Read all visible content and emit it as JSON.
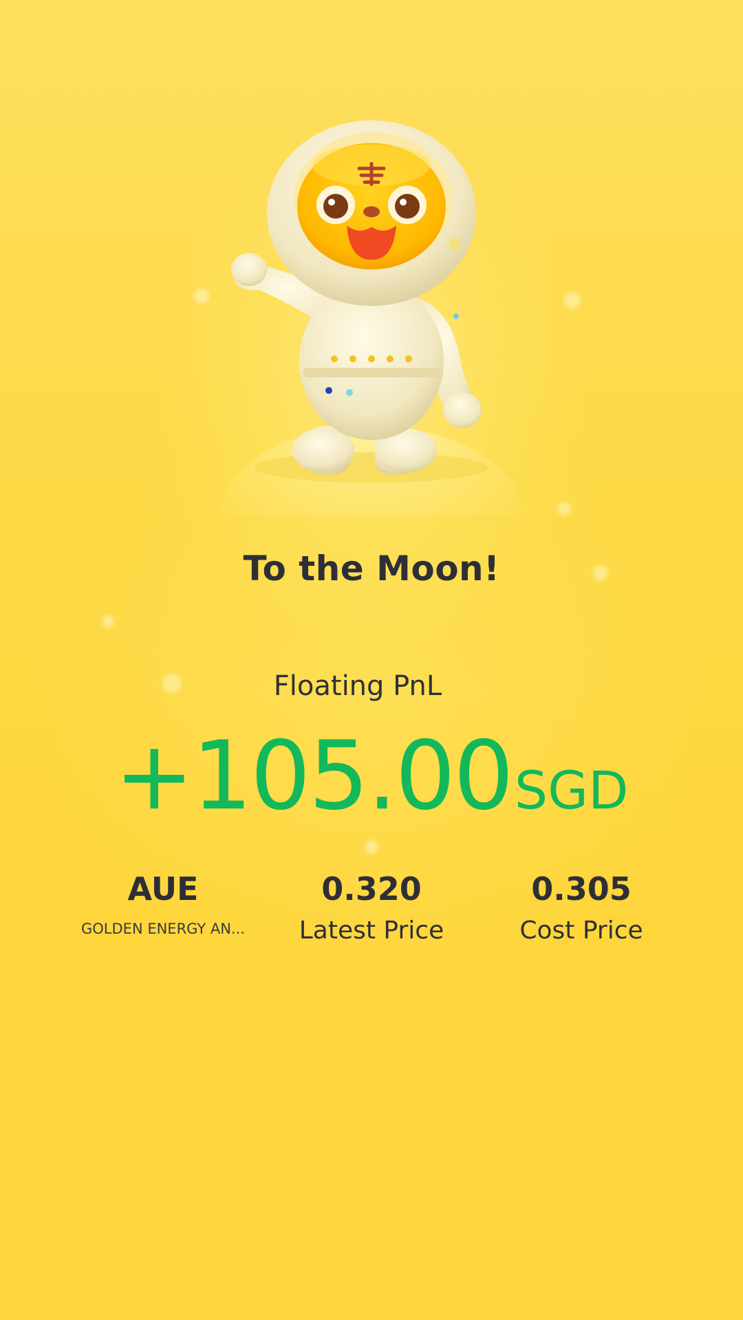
{
  "theme": {
    "background": "#fdd93a",
    "text_color": "#2e2f36",
    "profit_color": "#12b85a"
  },
  "hero": {
    "illustration": "astronaut-tiger-mascot",
    "title": "To the Moon!"
  },
  "pnl": {
    "label": "Floating PnL",
    "amount": "+105.00",
    "currency": "SGD"
  },
  "stock": {
    "symbol": "AUE",
    "name": "GOLDEN ENERGY AN..."
  },
  "latest_price": {
    "value": "0.320",
    "label": "Latest Price"
  },
  "cost_price": {
    "value": "0.305",
    "label": "Cost Price"
  }
}
